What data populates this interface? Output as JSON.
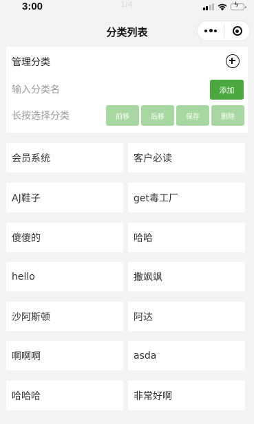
{
  "status_bar": {
    "time": "3:00",
    "center_text": "1/4"
  },
  "nav": {
    "title": "分类列表"
  },
  "manage": {
    "title": "管理分类",
    "input_placeholder": "输入分类名",
    "input_value": "",
    "add_label": "添加",
    "hint": "长按选择分类",
    "ops": [
      "前移",
      "后移",
      "保存",
      "删除"
    ]
  },
  "categories": [
    "会员系统",
    "客户必读",
    "AJ鞋子",
    "get毒工厂",
    "傻傻的",
    "哈哈",
    "hello",
    "撒飒飒",
    "沙阿斯顿",
    "阿达",
    "啊啊啊",
    "asda",
    "哈哈哈",
    "非常好啊"
  ],
  "colors": {
    "accent": "#4aa83f",
    "accent_disabled": "#a8d8a1",
    "page_bg": "#f3f3f3"
  }
}
